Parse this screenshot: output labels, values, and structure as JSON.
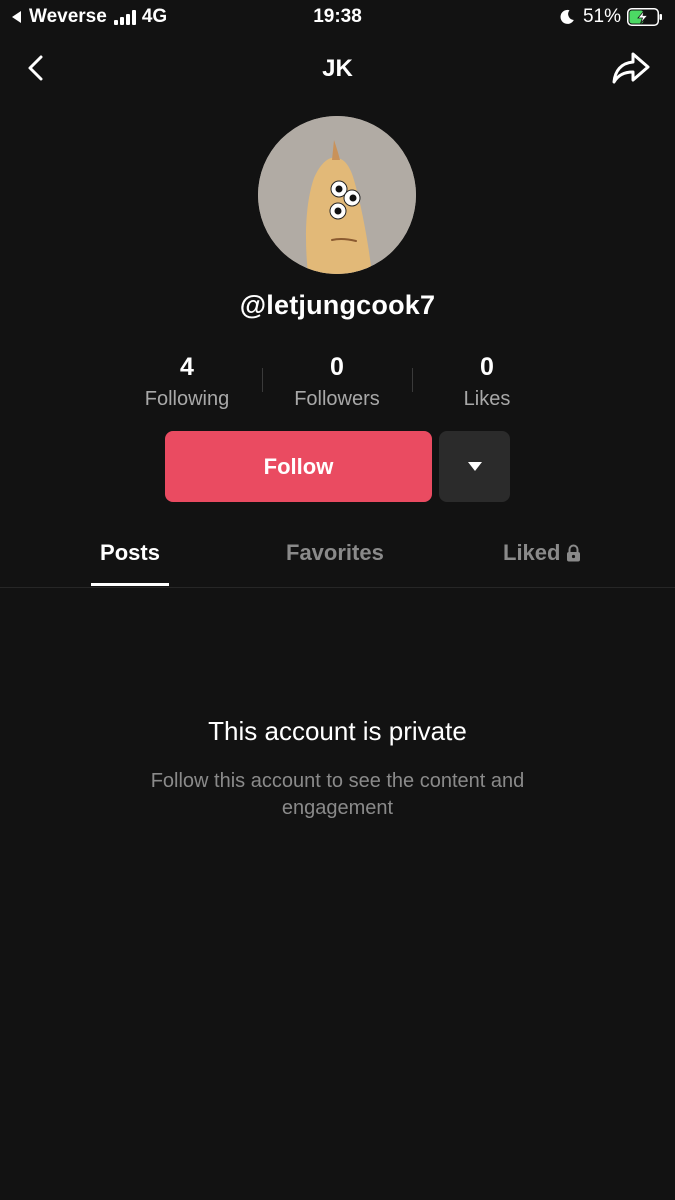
{
  "status_bar": {
    "back_app": "Weverse",
    "network": "4G",
    "time": "19:38",
    "battery_percent": "51%",
    "battery_level": 0.51,
    "battery_color": "#4cd964"
  },
  "header": {
    "title": "JK",
    "back_icon": "chevron-left-icon",
    "share_icon": "share-arrow-icon"
  },
  "profile": {
    "username": "@letjungcook7",
    "stats": [
      {
        "value": "4",
        "label": "Following"
      },
      {
        "value": "0",
        "label": "Followers"
      },
      {
        "value": "0",
        "label": "Likes"
      }
    ],
    "follow_label": "Follow",
    "follow_color": "#ea4b61"
  },
  "tabs": [
    {
      "label": "Posts",
      "active": true
    },
    {
      "label": "Favorites",
      "active": false
    },
    {
      "label": "Liked",
      "active": false,
      "locked": true
    }
  ],
  "private_notice": {
    "title": "This account is private",
    "description": "Follow this account to see the content and engagement"
  }
}
